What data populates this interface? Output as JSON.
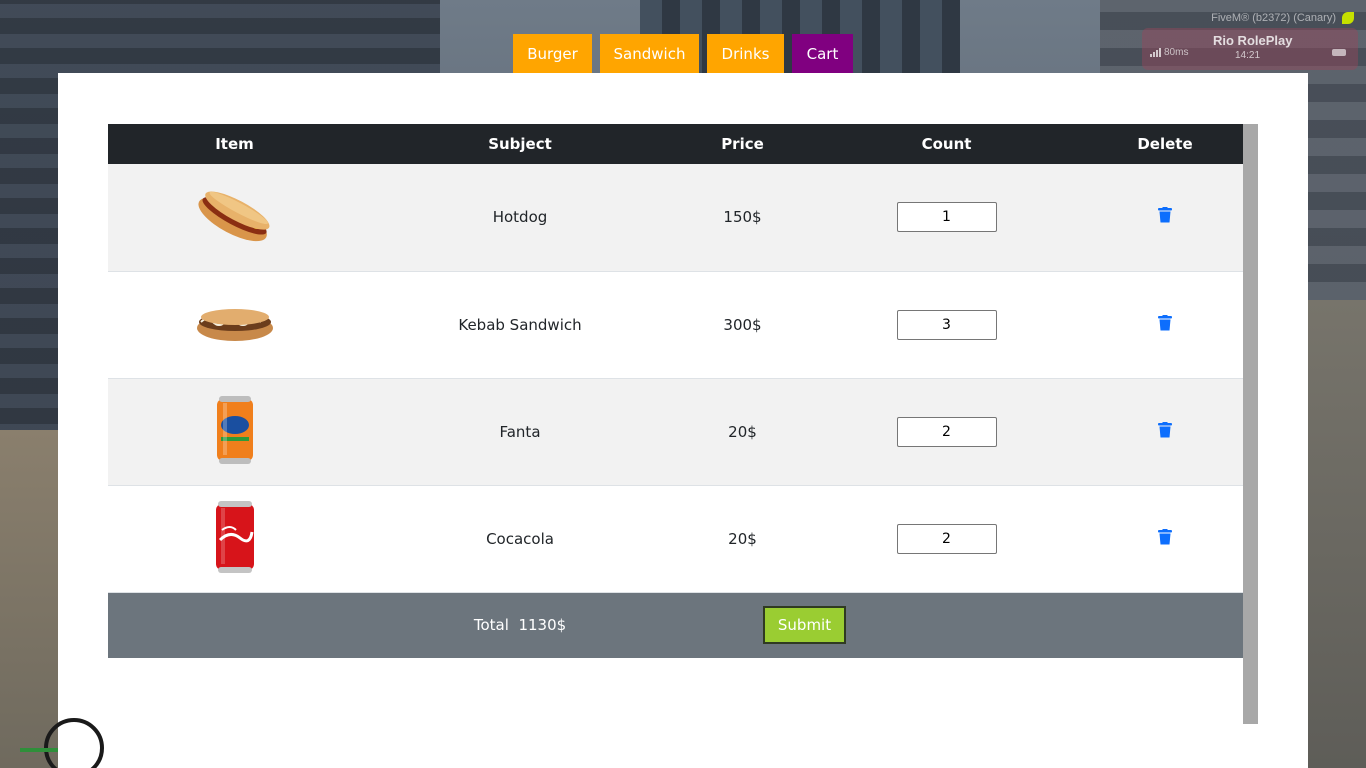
{
  "overlay": {
    "build": "FiveM® (b2372) (Canary)",
    "ping": "80ms",
    "server": "Rio RolePlay",
    "time": "14:21"
  },
  "tabs": [
    {
      "label": "Burger",
      "active": false
    },
    {
      "label": "Sandwich",
      "active": false
    },
    {
      "label": "Drinks",
      "active": false
    },
    {
      "label": "Cart",
      "active": true
    }
  ],
  "colors": {
    "tab": "#ffa500",
    "tab_active": "#800080",
    "table_header": "#212529",
    "total_row": "#6c757d",
    "submit": "#9acd32",
    "trash": "#0d6efd"
  },
  "cart": {
    "columns": [
      "Item",
      "Subject",
      "Price",
      "Count",
      "Delete"
    ],
    "rows": [
      {
        "image_icon": "hotdog-icon",
        "subject": "Hotdog",
        "price": "150$",
        "count": "1"
      },
      {
        "image_icon": "kebab-sandwich-icon",
        "subject": "Kebab Sandwich",
        "price": "300$",
        "count": "3"
      },
      {
        "image_icon": "fanta-can-icon",
        "subject": "Fanta",
        "price": "20$",
        "count": "2"
      },
      {
        "image_icon": "cocacola-can-icon",
        "subject": "Cocacola",
        "price": "20$",
        "count": "2"
      }
    ],
    "total_label": "Total",
    "total_value": "1130$",
    "submit_label": "Submit"
  }
}
